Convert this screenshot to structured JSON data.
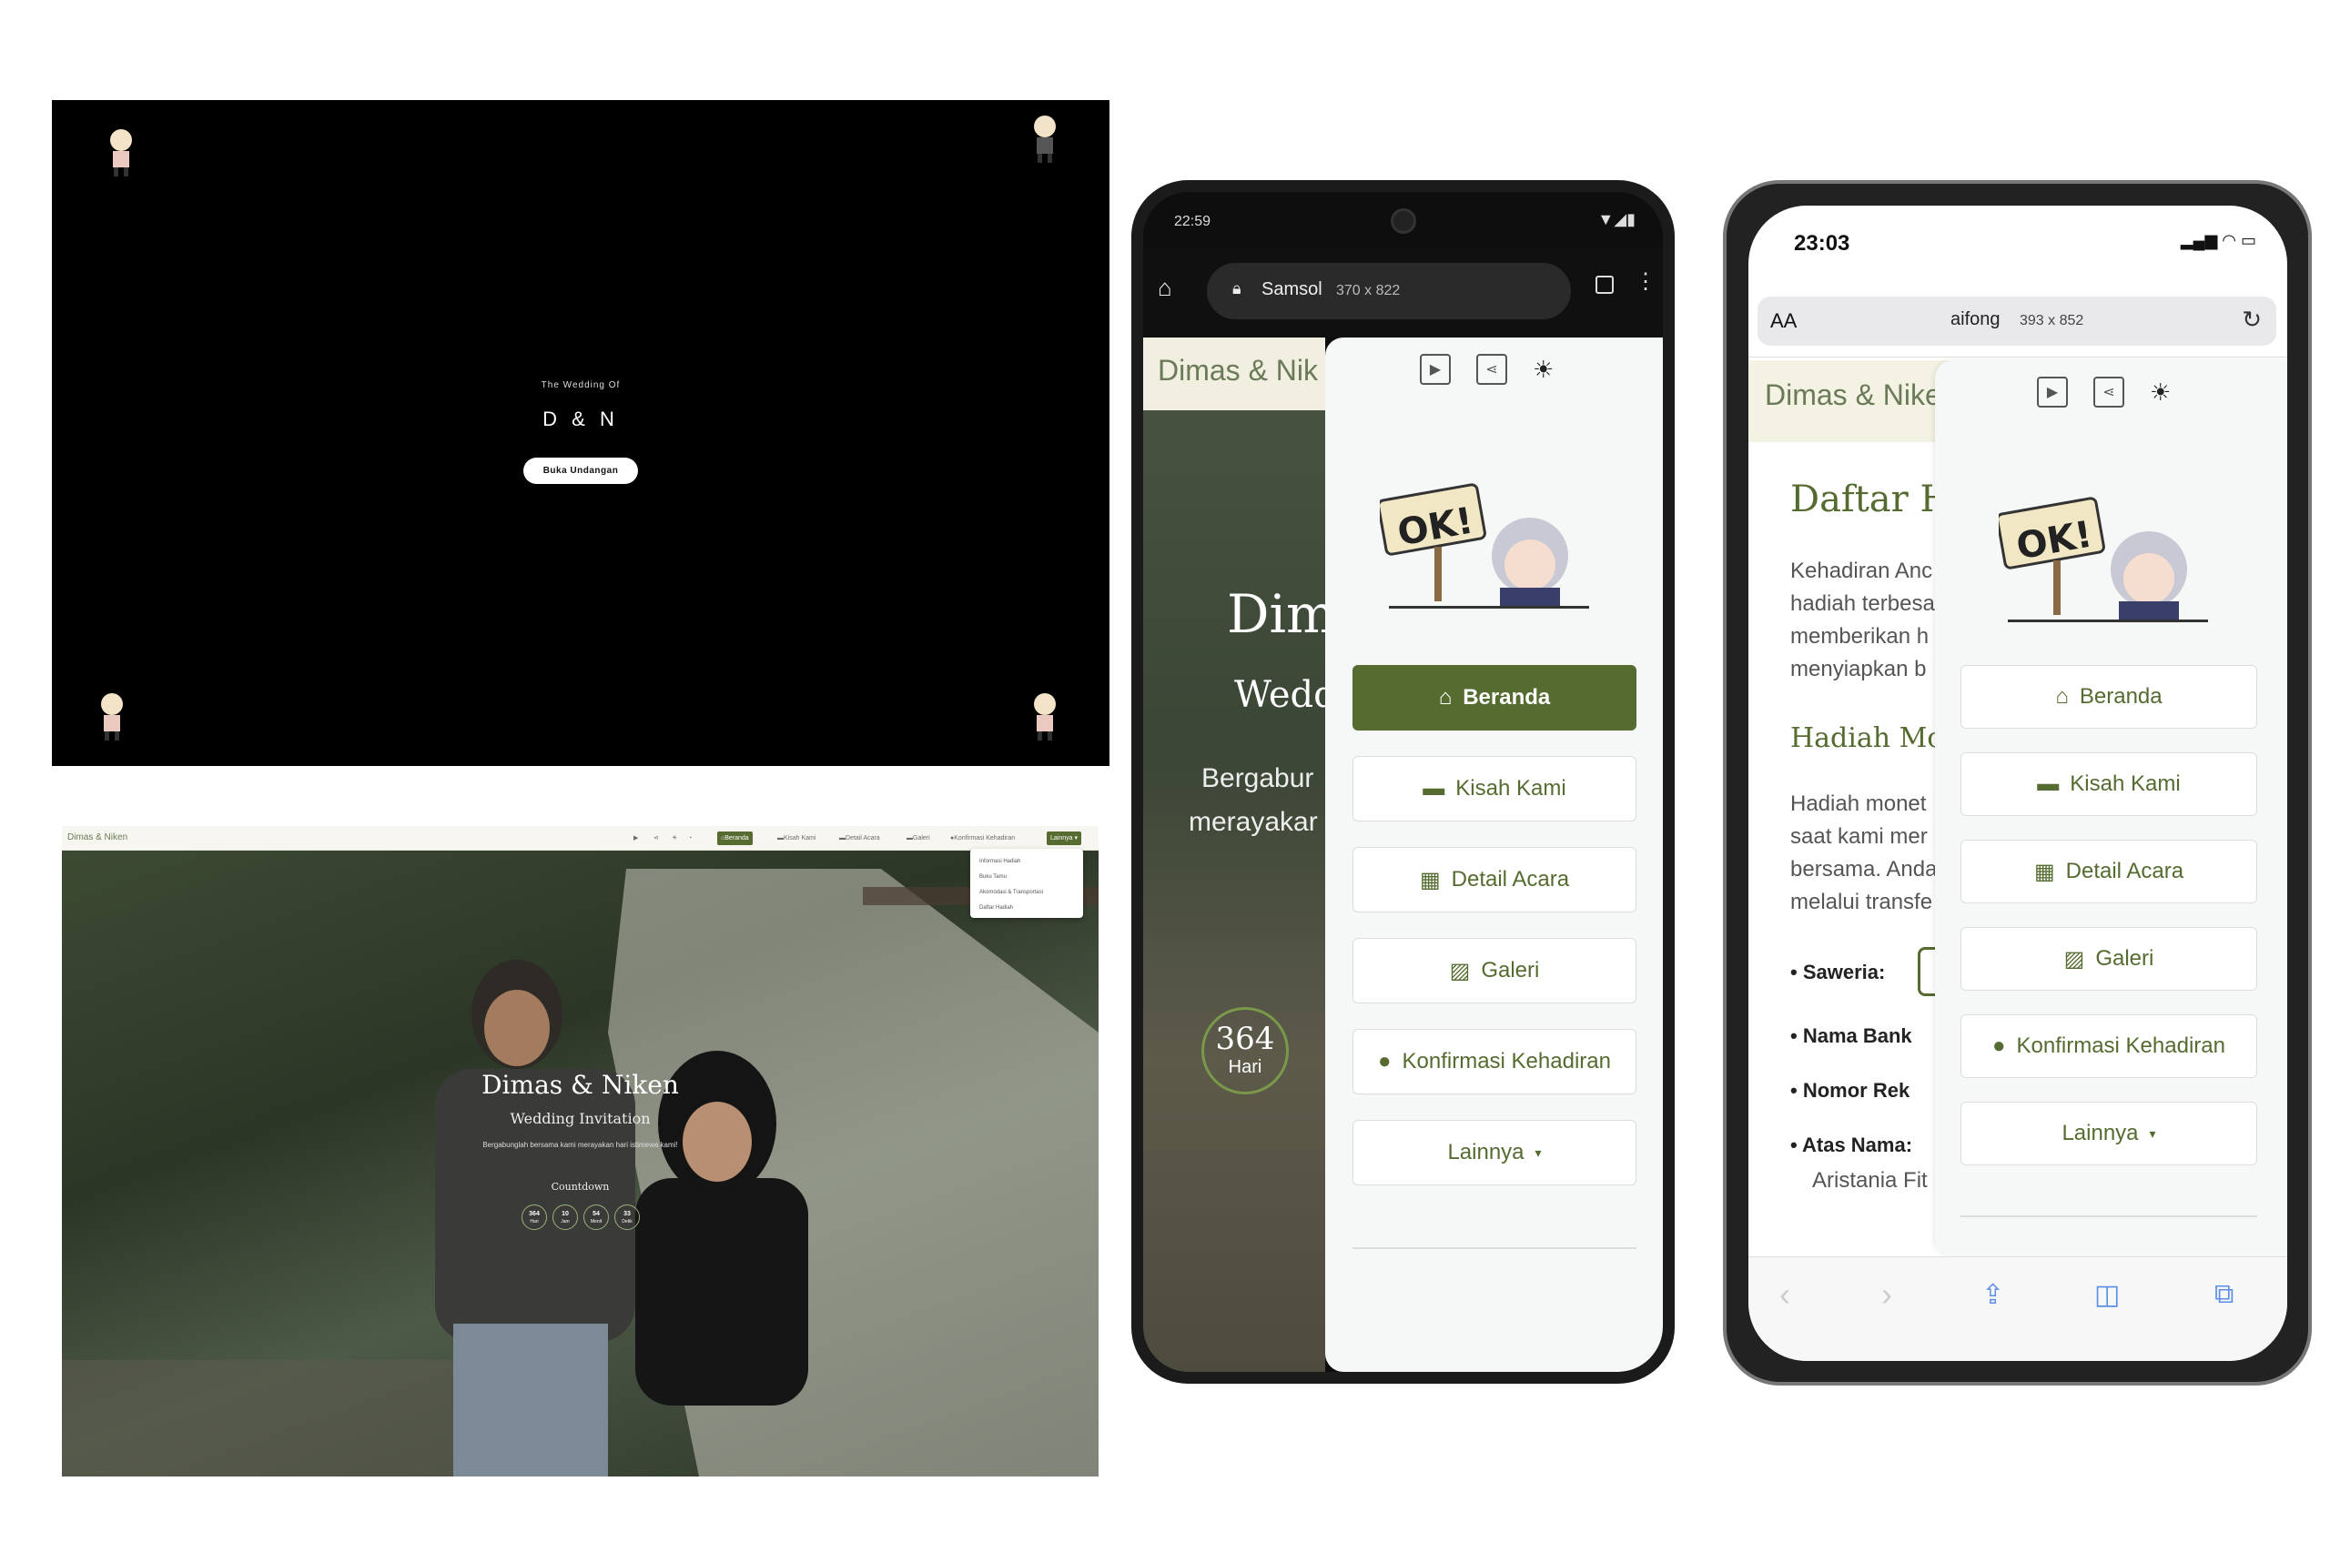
{
  "desktop_splash": {
    "subtitle": "The Wedding Of",
    "initials": "D & N",
    "open_button": "Buka Undangan"
  },
  "desktop_site": {
    "brand": "Dimas & Niken",
    "nav": [
      "Beranda",
      "Kisah Kami",
      "Detail Acara",
      "Galeri",
      "Konfirmasi Kehadiran"
    ],
    "more_label": "Lainnya",
    "dropdown": [
      "Informasi Hadiah",
      "Buku Tamu",
      "Akomodasi & Transportasi",
      "Daftar Hadiah"
    ],
    "hero_title": "Dimas & Niken",
    "hero_subtitle": "Wedding Invitation",
    "hero_text": "Bergabunglah bersama kami merayakan hari istimewa kami!",
    "countdown_label": "Countdown",
    "countdown": [
      {
        "value": "364",
        "unit": "Hari"
      },
      {
        "value": "10",
        "unit": "Jam"
      },
      {
        "value": "54",
        "unit": "Menit"
      },
      {
        "value": "33",
        "unit": "Detik"
      }
    ]
  },
  "android": {
    "time": "22:59",
    "url_name": "Samsol",
    "url_size": "370 x 822",
    "brand": "Dimas & Nik",
    "bg_title_1": "Dim",
    "bg_title_2": "Wedd",
    "bg_text_1": "Bergabur",
    "bg_text_2": "merayakar",
    "bg_count": "364",
    "bg_unit": "Hari",
    "menu": [
      "Beranda",
      "Kisah Kami",
      "Detail Acara",
      "Galeri",
      "Konfirmasi Kehadiran",
      "Lainnya"
    ],
    "sticker": "OK!"
  },
  "iphone": {
    "time": "23:03",
    "aa": "AA",
    "url_name": "aifong",
    "url_size": "393 x 852",
    "brand": "Dimas & Nike",
    "page_title": "Daftar H",
    "intro": [
      "Kehadiran Anc",
      "hadiah terbesa",
      "memberikan h",
      "menyiapkan b"
    ],
    "section": "Hadiah Mon",
    "section_text": [
      "Hadiah monet",
      "saat kami mer",
      "bersama. Anda",
      "melalui transfe"
    ],
    "list": [
      "Saweria:",
      "Nama Bank",
      "Nomor Rek",
      "Atas Nama:"
    ],
    "name_value": "Aristania Fit",
    "menu": [
      "Beranda",
      "Kisah Kami",
      "Detail Acara",
      "Galeri",
      "Konfirmasi Kehadiran",
      "Lainnya"
    ],
    "sticker": "OK!"
  },
  "colors": {
    "accent": "#556b2f",
    "menu_bg": "#f5f8f6"
  }
}
